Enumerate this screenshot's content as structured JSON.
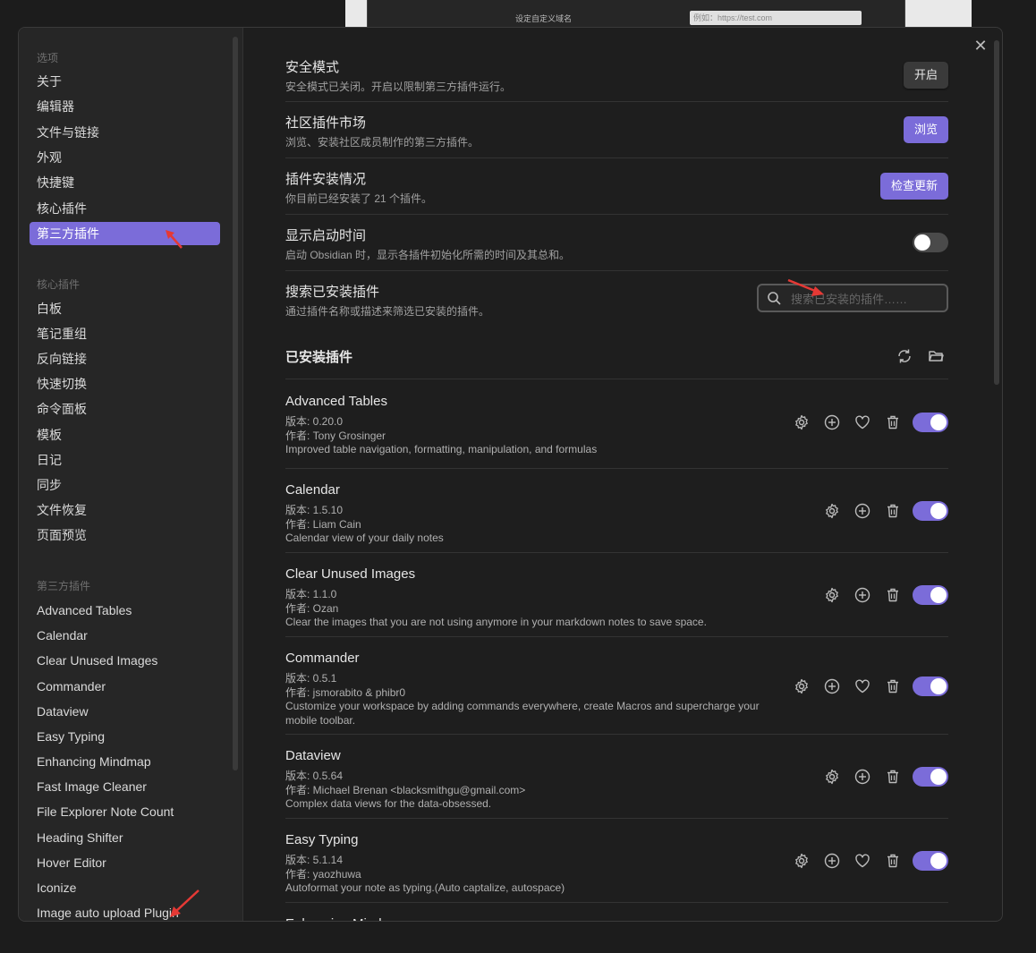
{
  "background": {
    "label": "设定自定义域名",
    "input_placeholder": "例如：https://test.com"
  },
  "sidebar": {
    "options_heading": "选项",
    "options": [
      "关于",
      "编辑器",
      "文件与链接",
      "外观",
      "快捷键",
      "核心插件",
      "第三方插件"
    ],
    "active": "第三方插件",
    "core_heading": "核心插件",
    "core": [
      "白板",
      "笔记重组",
      "反向链接",
      "快速切换",
      "命令面板",
      "模板",
      "日记",
      "同步",
      "文件恢复",
      "页面预览"
    ],
    "community_heading": "第三方插件",
    "community": [
      "Advanced Tables",
      "Calendar",
      "Clear Unused Images",
      "Commander",
      "Dataview",
      "Easy Typing",
      "Enhancing Mindmap",
      "Fast Image Cleaner",
      "File Explorer Note Count",
      "Heading Shifter",
      "Hover Editor",
      "Iconize",
      "Image auto upload Plugin"
    ]
  },
  "settings": {
    "safe_mode": {
      "name": "安全模式",
      "desc": "安全模式已关闭。开启以限制第三方插件运行。",
      "button": "开启"
    },
    "market": {
      "name": "社区插件市场",
      "desc": "浏览、安装社区成员制作的第三方插件。",
      "button": "浏览"
    },
    "installed_status": {
      "name": "插件安装情况",
      "desc": "你目前已经安装了 21 个插件。",
      "button": "检查更新"
    },
    "startup_time": {
      "name": "显示启动时间",
      "desc": "启动 Obsidian 时，显示各插件初始化所需的时间及其总和。",
      "enabled": false
    },
    "search": {
      "name": "搜索已安装插件",
      "desc": "通过插件名称或描述来筛选已安装的插件。",
      "placeholder": "搜索已安装的插件……"
    }
  },
  "installed_heading": "已安装插件",
  "plugins": [
    {
      "name": "Advanced Tables",
      "version": "版本: 0.20.0",
      "author": "作者:  Tony Grosinger",
      "desc": "Improved table navigation, formatting, manipulation, and formulas",
      "has_donate": true,
      "enabled": true
    },
    {
      "name": "Calendar",
      "version": "版本: 1.5.10",
      "author": "作者:  Liam Cain",
      "desc": "Calendar view of your daily notes",
      "has_donate": false,
      "enabled": true
    },
    {
      "name": "Clear Unused Images",
      "version": "版本: 1.1.0",
      "author": "作者:  Ozan",
      "desc": "Clear the images that you are not using anymore in your markdown notes to save space.",
      "has_donate": false,
      "enabled": true
    },
    {
      "name": "Commander",
      "version": "版本: 0.5.1",
      "author": "作者:  jsmorabito & phibr0",
      "desc": "Customize your workspace by adding commands everywhere, create Macros and supercharge your mobile toolbar.",
      "has_donate": true,
      "enabled": true
    },
    {
      "name": "Dataview",
      "version": "版本: 0.5.64",
      "author": "作者:  Michael Brenan <blacksmithgu@gmail.com>",
      "desc": "Complex data views for the data-obsessed.",
      "has_donate": false,
      "enabled": true
    },
    {
      "name": "Easy Typing",
      "version": "版本: 5.1.14",
      "author": "作者:  yaozhuwa",
      "desc": "Autoformat your note as typing.(Auto captalize, autospace)",
      "has_donate": true,
      "enabled": true
    },
    {
      "name": "Enhancing Mindmap"
    }
  ],
  "colors": {
    "accent": "#7b6cd9",
    "annotation_arrow": "#e53935"
  }
}
